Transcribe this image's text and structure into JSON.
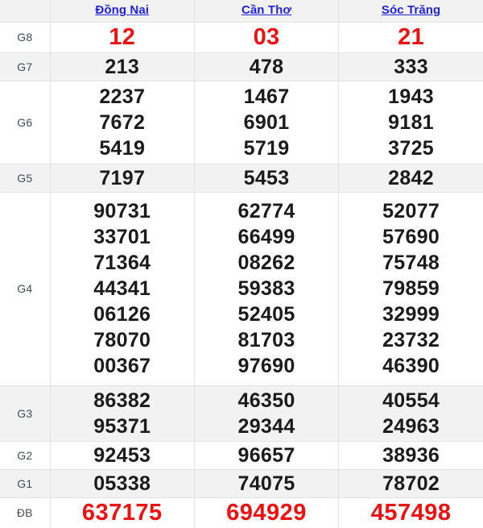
{
  "table": {
    "columns": [
      {
        "label": "Đồng Nai",
        "icon": "link"
      },
      {
        "label": "Cần Thơ",
        "icon": "link"
      },
      {
        "label": "Sóc Trăng",
        "icon": "link"
      }
    ],
    "label_column_header": "",
    "accent_link_color": "#2222dd",
    "highlight_color": "#ee1111",
    "stripe_color": "#f2f2f2",
    "text_color": "#1b1b1b",
    "rows": [
      {
        "prize": "G8",
        "cells": [
          [
            "12"
          ],
          [
            "03"
          ],
          [
            "21"
          ]
        ]
      },
      {
        "prize": "G7",
        "cells": [
          [
            "213"
          ],
          [
            "478"
          ],
          [
            "333"
          ]
        ]
      },
      {
        "prize": "G6",
        "cells": [
          [
            "2237",
            "7672",
            "5419"
          ],
          [
            "1467",
            "6901",
            "5719"
          ],
          [
            "1943",
            "9181",
            "3725"
          ]
        ]
      },
      {
        "prize": "G5",
        "cells": [
          [
            "7197"
          ],
          [
            "5453"
          ],
          [
            "2842"
          ]
        ]
      },
      {
        "prize": "G4",
        "cells": [
          [
            "90731",
            "33701",
            "71364",
            "44341",
            "06126",
            "78070",
            "00367"
          ],
          [
            "62774",
            "66499",
            "08262",
            "59383",
            "52405",
            "81703",
            "97690"
          ],
          [
            "52077",
            "57690",
            "75748",
            "79859",
            "32999",
            "23732",
            "46390"
          ]
        ]
      },
      {
        "prize": "G3",
        "cells": [
          [
            "86382",
            "95371"
          ],
          [
            "46350",
            "29344"
          ],
          [
            "40554",
            "24963"
          ]
        ]
      },
      {
        "prize": "G2",
        "cells": [
          [
            "92453"
          ],
          [
            "96657"
          ],
          [
            "38936"
          ]
        ]
      },
      {
        "prize": "G1",
        "cells": [
          [
            "05338"
          ],
          [
            "74075"
          ],
          [
            "78702"
          ]
        ]
      },
      {
        "prize": "ĐB",
        "cells": [
          [
            "637175"
          ],
          [
            "694929"
          ],
          [
            "457498"
          ]
        ]
      }
    ]
  }
}
